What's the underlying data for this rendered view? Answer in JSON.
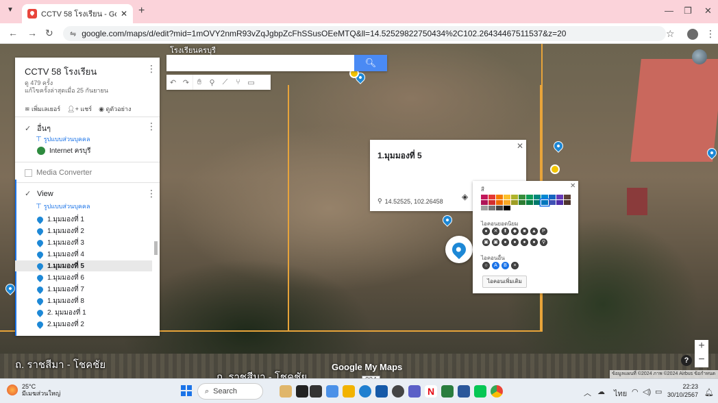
{
  "browser": {
    "tab_title": "CCTV 58 โรงเรียน - Google My M",
    "url": "google.com/maps/d/edit?mid=1mOVY2nmR93vZqJgbpZcFhSSusOEeMTQ&ll=14.52529822750434%2C102.26434467511537&z=20"
  },
  "map": {
    "school_label": "โรงเรียนครบุรี",
    "road_label_left": "ถ. ราชสีมา - โชคชัย",
    "road_label_mid": "ถ. ราชสีมา - โชคชัย",
    "logo": "Google My Maps",
    "road_badge": "224",
    "attribution": "ข้อมูลแผนที่ ©2024 ภาพ ©2024 Airbus   ข้อกำหนด",
    "search_placeholder": "",
    "search_icon": "search-icon"
  },
  "panel": {
    "title": "CCTV 58 โรงเรียน",
    "views": "ดู 479 ครั้ง",
    "updated": "แก้ไขครั้งล่าสุดเมื่อ 25 กันยายน",
    "actions": {
      "add_layer": "เพิ่มเลเยอร์",
      "share": "แชร์",
      "preview": "ดูตัวอย่าง"
    },
    "layer1": {
      "name": "อื่นๆ",
      "style": "รูปแบบส่วนบุคคล",
      "item": "Internet ครบุรี"
    },
    "layer2": {
      "name": "Media Converter"
    },
    "layer3": {
      "name": "View",
      "style": "รูปแบบส่วนบุคคล",
      "items": [
        "1.มุมมองที่ 1",
        "1.มุมมองที่ 2",
        "1.มุมมองที่ 3",
        "1.มุมมองที่ 4",
        "1.มุมมองที่ 5",
        "1.มุมมองที่ 6",
        "1.มุมมองที่ 7",
        "1.มุมมองที่ 8",
        "2. มุมมองที่ 1",
        "2.มุมมองที่ 2"
      ],
      "selected_index": 4
    }
  },
  "popup": {
    "title": "1.มุมมองที่ 5",
    "coords": "14.52525, 102.26458"
  },
  "picker": {
    "color_label": "สี",
    "popular_icons_label": "ไอคอนยอดนิยม",
    "other_icons_label": "ไอคอนอื่น",
    "more_icons_button": "ไอคอนเพิ่มเติม",
    "colors": [
      "#c2185b",
      "#e53935",
      "#f57c00",
      "#fbc02d",
      "#afb42b",
      "#388e3c",
      "#0f9d58",
      "#00897b",
      "#0288d1",
      "#1565c0",
      "#673ab7",
      "#5d4037",
      "#ad1457",
      "#d32f2f",
      "#ef6c00",
      "#f9a825",
      "#9e9d24",
      "#2e7d32",
      "#0b8043",
      "#00796b",
      "#0277bd",
      "#3f51b5",
      "#512da8",
      "#4e342e",
      "#9e9e9e",
      "#757575",
      "#424242",
      "#000000"
    ],
    "selected_color_index": 20,
    "popular_icons": [
      "●",
      "✕",
      "⬆",
      "◆",
      "■",
      "▲",
      "P",
      "▣",
      "▣",
      "●",
      "●",
      "●",
      "●",
      "⚲"
    ],
    "other_icons": [
      "○",
      "A",
      "B",
      "×"
    ],
    "other_selected": [
      false,
      true,
      true,
      false
    ]
  },
  "taskbar": {
    "temp": "25°C",
    "weather_desc": "มีเมฆส่วนใหญ่",
    "search": "Search",
    "lang": "ไทย",
    "time": "22:23",
    "date": "30/10/2567"
  }
}
